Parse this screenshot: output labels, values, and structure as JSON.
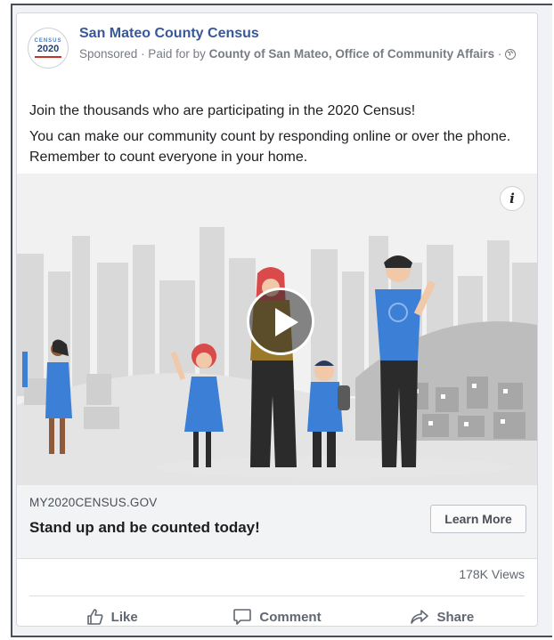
{
  "post": {
    "page_name": "San Mateo County Census",
    "sponsored": "Sponsored",
    "paid_for_prefix": " · Paid for by ",
    "paid_for": "County of San Mateo, Office of Community Affairs",
    "meta_suffix": " · ",
    "avatar": {
      "line1": "CENSUS",
      "line2": "2020"
    },
    "text_line1": "Join the thousands who are participating in the 2020 Census!",
    "text_line2": "You can make our community count by responding online or over the phone. Remember to count everyone in your home."
  },
  "media": {
    "info_label": "i",
    "icon": "play-icon"
  },
  "cta": {
    "domain": "MY2020CENSUS.GOV",
    "headline": "Stand up and be counted today!",
    "button": "Learn More"
  },
  "stats": {
    "views": "178K Views"
  },
  "actions": {
    "like": "Like",
    "comment": "Comment",
    "share": "Share"
  },
  "colors": {
    "brand": "#385898",
    "figure_blue": "#3b7fd6",
    "figure_red": "#d94a4a"
  }
}
